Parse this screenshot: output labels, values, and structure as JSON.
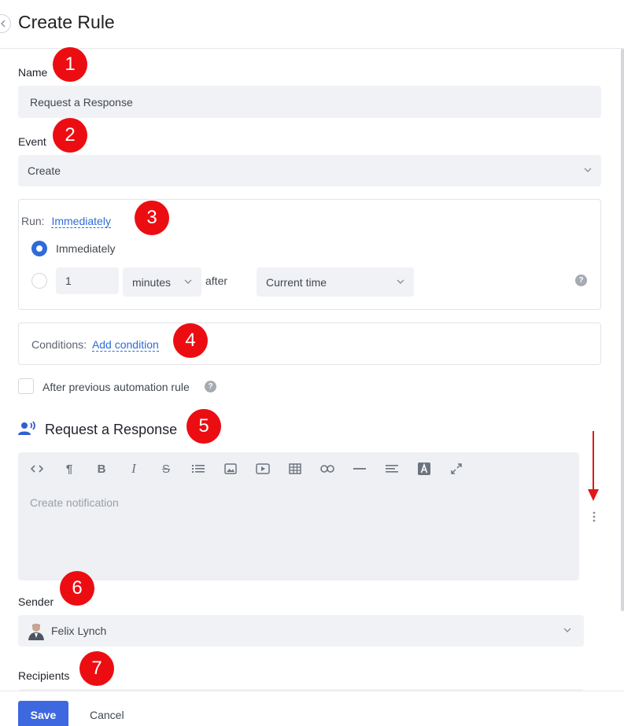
{
  "header": {
    "title": "Create Rule"
  },
  "name": {
    "label": "Name",
    "value": "Request a Response"
  },
  "event": {
    "label": "Event",
    "value": "Create"
  },
  "run": {
    "label": "Run:",
    "value_link": "Immediately",
    "option_immediately": "Immediately",
    "delay_value": "1",
    "delay_unit": "minutes",
    "after_label": "after",
    "reference": "Current time"
  },
  "conditions": {
    "label": "Conditions:",
    "add_link": "Add condition"
  },
  "after_previous": {
    "label": "After previous automation rule"
  },
  "action": {
    "title": "Request a Response",
    "icon": "person-speaking-icon"
  },
  "editor": {
    "placeholder": "Create notification",
    "toolbar": [
      "code-view-icon",
      "paragraph-icon",
      "bold-icon",
      "italic-icon",
      "strikethrough-icon",
      "list-icon",
      "image-icon",
      "video-icon",
      "table-icon",
      "link-icon",
      "horizontal-line-icon",
      "align-icon",
      "text-color-icon",
      "fullscreen-icon"
    ]
  },
  "sender": {
    "label": "Sender",
    "value": "Felix Lynch"
  },
  "recipients": {
    "label": "Recipients"
  },
  "footer": {
    "save_label": "Save",
    "cancel_label": "Cancel"
  },
  "annotations": [
    "1",
    "2",
    "3",
    "4",
    "5",
    "6",
    "7"
  ],
  "colors": {
    "accent": "#2f6bd8",
    "primary_button": "#3d68e0",
    "annotation_badge": "#ec0d12",
    "annotation_arrow": "#e0181c"
  }
}
